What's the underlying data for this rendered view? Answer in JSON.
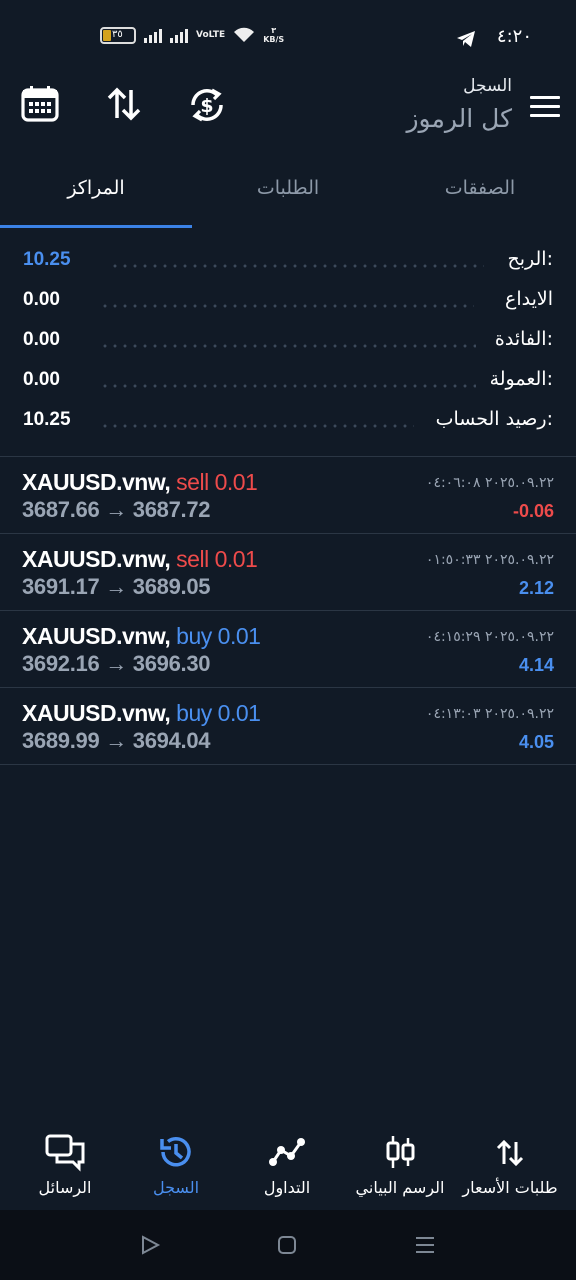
{
  "status_bar": {
    "time": "٤:٢٠",
    "battery": "٣٥",
    "network": "VoLTE",
    "speed_value": "٣",
    "speed_unit": "KB/S"
  },
  "header": {
    "subtitle": "السجل",
    "title": "كل الرموز",
    "icons": [
      "menu-icon",
      "sync-dollar-icon",
      "sort-arrows-icon",
      "calendar-icon"
    ]
  },
  "tabs": [
    {
      "label": "الصفقات",
      "active": false
    },
    {
      "label": "الطلبات",
      "active": false
    },
    {
      "label": "المراكز",
      "active": true
    }
  ],
  "summary": [
    {
      "label": "الربح:",
      "value": "10.25",
      "highlight": true
    },
    {
      "label": "الايداع",
      "value": "0.00",
      "highlight": false
    },
    {
      "label": "الفائدة:",
      "value": "0.00",
      "highlight": false
    },
    {
      "label": "العمولة:",
      "value": "0.00",
      "highlight": false
    },
    {
      "label": "رصيد الحساب:",
      "value": "10.25",
      "highlight": false
    }
  ],
  "positions": [
    {
      "symbol": "XAUUSD.vnw,",
      "side": "sell",
      "volume": "0.01",
      "open": "3687.66",
      "arrow": "→",
      "close": "3687.72",
      "time": "٢٠٢٥.٠٩.٢٢ ٠٤:٠٦:٠٨",
      "profit": "-0.06"
    },
    {
      "symbol": "XAUUSD.vnw,",
      "side": "sell",
      "volume": "0.01",
      "open": "3691.17",
      "arrow": "→",
      "close": "3689.05",
      "time": "٢٠٢٥.٠٩.٢٢ ٠١:٥٠:٣٣",
      "profit": "2.12"
    },
    {
      "symbol": "XAUUSD.vnw,",
      "side": "buy",
      "volume": "0.01",
      "open": "3692.16",
      "arrow": "→",
      "close": "3696.30",
      "time": "٢٠٢٥.٠٩.٢٢ ٠٤:١٥:٢٩",
      "profit": "4.14"
    },
    {
      "symbol": "XAUUSD.vnw,",
      "side": "buy",
      "volume": "0.01",
      "open": "3689.99",
      "arrow": "→",
      "close": "3694.04",
      "time": "٢٠٢٥.٠٩.٢٢ ٠٤:١٣:٠٣",
      "profit": "4.05"
    }
  ],
  "bottom_nav": [
    {
      "label": "طلبات الأسعار",
      "icon": "quotes-arrows-icon",
      "active": false
    },
    {
      "label": "الرسم البياني",
      "icon": "candlestick-icon",
      "active": false
    },
    {
      "label": "التداول",
      "icon": "trade-line-icon",
      "active": false
    },
    {
      "label": "السجل",
      "icon": "history-icon",
      "active": true
    },
    {
      "label": "الرسائل",
      "icon": "messages-icon",
      "active": false
    }
  ],
  "colors": {
    "background": "#111a26",
    "accent": "#4a8fef",
    "sell": "#ee4b4b",
    "muted": "#9aa5b4"
  }
}
